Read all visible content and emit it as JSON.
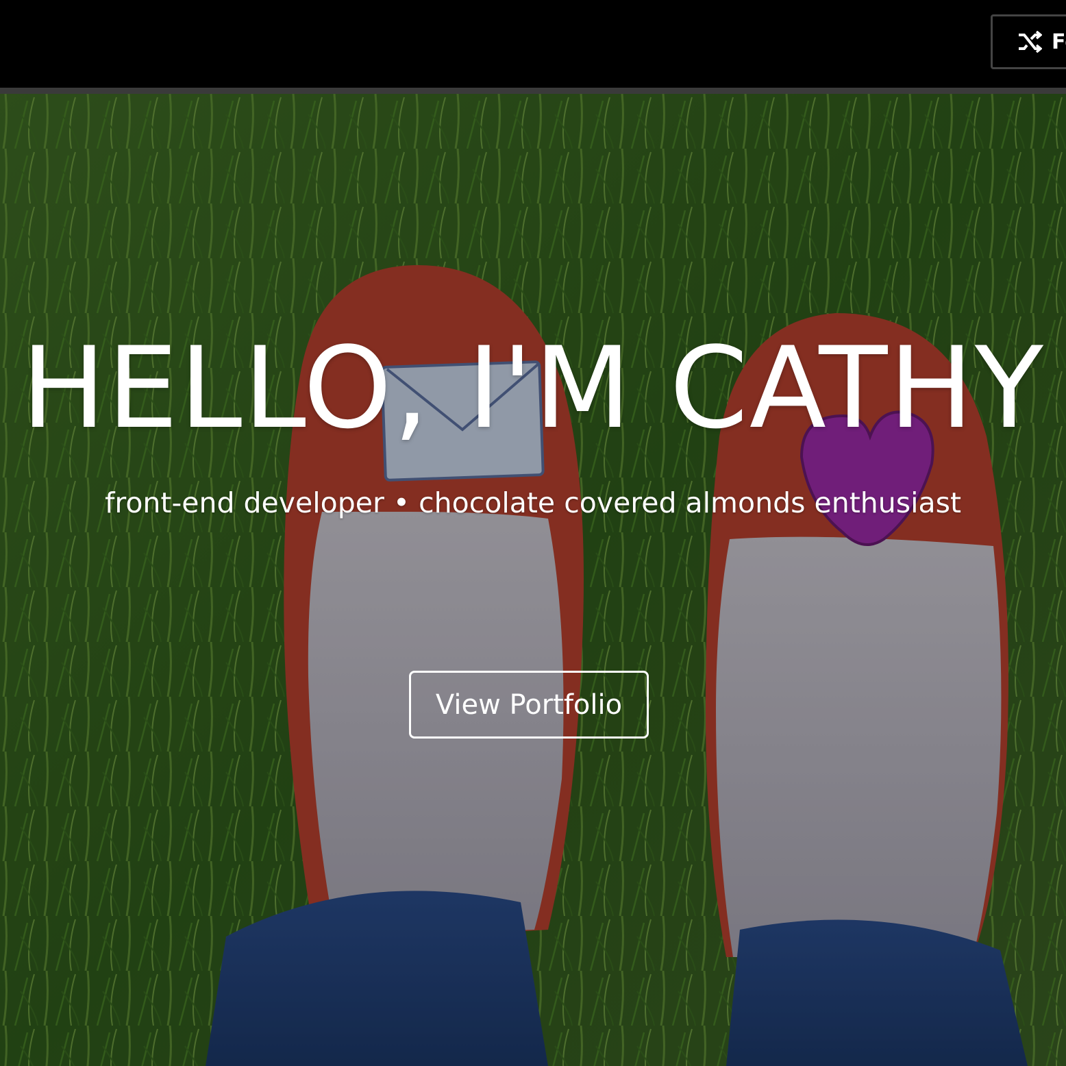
{
  "header": {
    "fork_button_label": "Fork",
    "fork_icon": "shuffle-icon"
  },
  "hero": {
    "title": "HELLO, I'M CATHY",
    "subtitle": "front-end developer • chocolate covered almonds enthusiast",
    "cta_label": "View Portfolio",
    "background_image": "red-shoes-on-grass-photo"
  },
  "colors": {
    "topbar": "#000000",
    "topbar_border": "#3a3a3a",
    "text": "#ffffff"
  }
}
